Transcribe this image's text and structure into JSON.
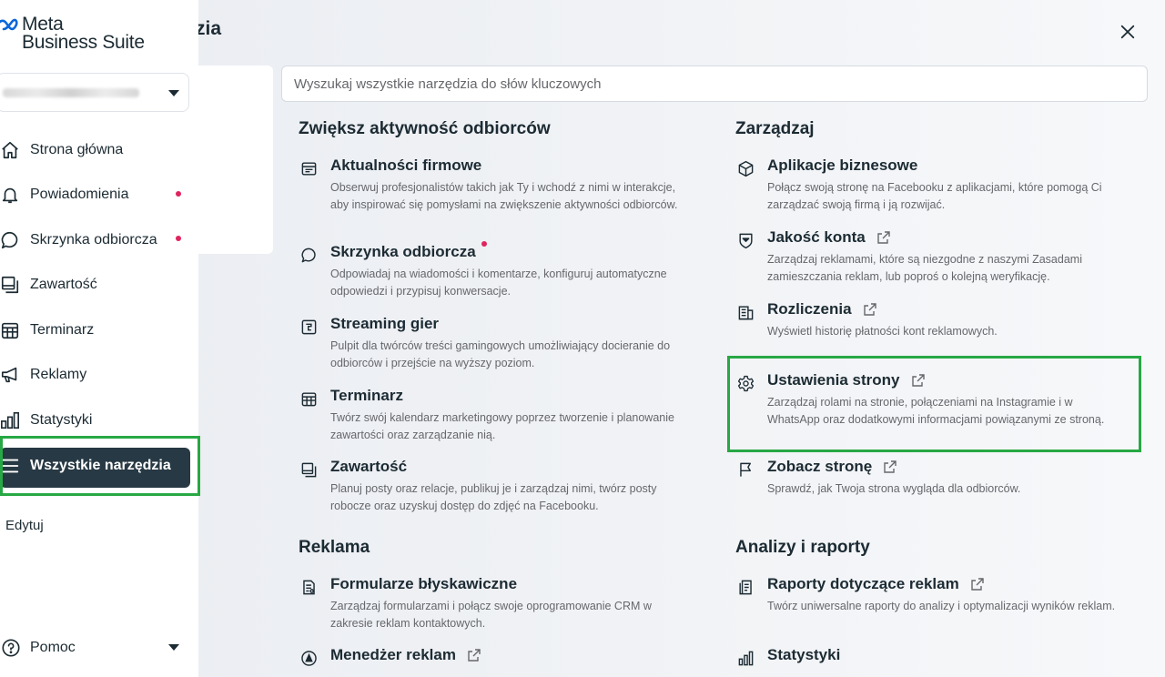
{
  "background": {
    "title_fragment": "zędzia"
  },
  "brand": {
    "line1": "Meta",
    "line2": "Business Suite"
  },
  "sidebar": {
    "items": [
      {
        "label": "Strona główna",
        "icon": "home-icon",
        "dot": false
      },
      {
        "label": "Powiadomienia",
        "icon": "bell-icon",
        "dot": true
      },
      {
        "label": "Skrzynka odbiorcza",
        "icon": "chat-bubble-icon",
        "dot": true
      },
      {
        "label": "Zawartość",
        "icon": "content-icon",
        "dot": false
      },
      {
        "label": "Terminarz",
        "icon": "calendar-icon",
        "dot": false
      },
      {
        "label": "Reklamy",
        "icon": "megaphone-icon",
        "dot": false
      },
      {
        "label": "Statystyki",
        "icon": "bar-chart-icon",
        "dot": false
      },
      {
        "label": "Wszystkie narzędzia",
        "icon": "menu-icon",
        "dot": false,
        "active": true
      }
    ],
    "edit_label": "Edytuj",
    "help_label": "Pomoc"
  },
  "search": {
    "placeholder": "Wyszukaj wszystkie narzędzia do słów kluczowych",
    "value": ""
  },
  "sections": {
    "engagement": {
      "title": "Zwiększ aktywność odbiorców",
      "tools": [
        {
          "title": "Aktualności firmowe",
          "desc": "Obserwuj profesjonalistów takich jak Ty i wchodź z nimi w interakcje, aby inspirować się pomysłami na zwiększenie aktywności odbiorców.",
          "icon": "news-feed-icon"
        },
        {
          "title": "Skrzynka odbiorcza",
          "desc": "Odpowiadaj na wiadomości i komentarze, konfiguruj automatyczne odpowiedzi i przypisuj konwersacje.",
          "icon": "chat-bubble-icon"
        },
        {
          "title": "Streaming gier",
          "desc": "Pulpit dla twórców treści gamingowych umożliwiający docieranie do odbiorców i przejście na wyższy poziom.",
          "icon": "gaming-icon"
        },
        {
          "title": "Terminarz",
          "desc": "Twórz swój kalendarz marketingowy poprzez tworzenie i planowanie zawartości oraz zarządzanie nią.",
          "icon": "calendar-icon"
        },
        {
          "title": "Zawartość",
          "desc": "Planuj posty oraz relacje, publikuj je i zarządzaj nimi, twórz posty robocze oraz uzyskuj dostęp do zdjęć na Facebooku.",
          "icon": "content-icon"
        }
      ]
    },
    "manage": {
      "title": "Zarządzaj",
      "tools": [
        {
          "title": "Aplikacje biznesowe",
          "desc": "Połącz swoją stronę na Facebooku z aplikacjami, które pomogą Ci zarządzać swoją firmą i ją rozwijać.",
          "icon": "cube-icon"
        },
        {
          "title": "Jakość konta",
          "desc": "Zarządzaj reklamami, które są niezgodne z naszymi Zasadami zamieszczania reklam, lub poproś o kolejną weryfikację.",
          "icon": "shield-icon"
        },
        {
          "title": "Rozliczenia",
          "desc": "Wyświetl historię płatności kont reklamowych.",
          "icon": "billing-icon"
        },
        {
          "title": "Ustawienia strony",
          "desc": "Zarządzaj rolami na stronie, połączeniami na Instagramie i w WhatsApp oraz dodatkowymi informacjami powiązanymi ze stroną.",
          "icon": "gear-icon"
        },
        {
          "title": "Zobacz stronę",
          "desc": "Sprawdź, jak Twoja strona wygląda dla odbiorców.",
          "icon": "flag-icon"
        }
      ]
    },
    "ads": {
      "title": "Reklama",
      "tools": [
        {
          "title": "Formularze błyskawiczne",
          "desc": "Zarządzaj formularzami i połącz swoje oprogramowanie CRM w zakresie reklam kontaktowych.",
          "icon": "form-icon"
        },
        {
          "title": "Menedżer reklam",
          "desc": "",
          "icon": "ads-manager-icon"
        }
      ]
    },
    "analytics": {
      "title": "Analizy i raporty",
      "tools": [
        {
          "title": "Raporty dotyczące reklam",
          "desc": "Twórz uniwersalne raporty do analizy i optymalizacji wyników reklam.",
          "icon": "report-icon"
        },
        {
          "title": "Statystyki",
          "desc": "",
          "icon": "bar-chart-icon"
        }
      ]
    }
  },
  "colors": {
    "accent_dark": "#273944",
    "notification_dot": "#e0245e",
    "highlight": "#27a844",
    "text": "#1c2b33",
    "muted": "#65676b"
  }
}
